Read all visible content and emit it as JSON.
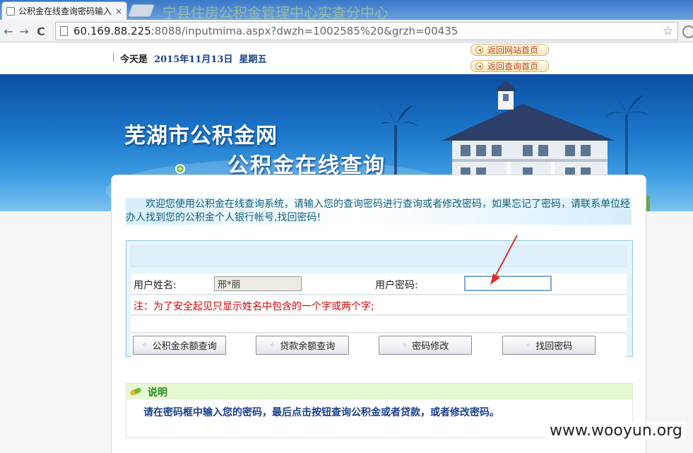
{
  "browser": {
    "tab_title": "公积金在线查询密码输入",
    "tab_close": "×",
    "background_text": "宁县住房公积金管理中心实查分中心",
    "url_host": "60.169.88.225",
    "url_rest": ":8088/inputmima.aspx?dwzh=1002585%20&grzh=00435",
    "back_glyph": "←",
    "forward_glyph": "→",
    "reload_glyph": "C",
    "star_glyph": "☆"
  },
  "topbar": {
    "today_label": "今天是",
    "date": "2015年11月13日",
    "weekday": "星期五",
    "link_home": "返回网站首页",
    "link_query_home": "返回查询首页"
  },
  "banner": {
    "title": "芜湖市公积金网",
    "subtitle": "公积金在线查询",
    "plus_glyph": "+"
  },
  "welcome": {
    "text": "欢迎您使用公积金在线查询系统，请输入您的查询密码进行查询或者修改密码，如果忘记了密码，请联系单位经办人找到您的公积金个人银行帐号,找回密码!"
  },
  "form": {
    "name_label": "用户姓名:",
    "name_value": "邢*丽",
    "password_label": "用户密码:",
    "password_value": "",
    "note": "注：为了安全起见只显示姓名中包含的一个字或两个字;",
    "buttons": {
      "fund_balance": "公积金余额查询",
      "loan_balance": "贷款余额查询",
      "change_password": "密码修改",
      "recover_password": "找回密码"
    },
    "btn_dots": "⁘"
  },
  "instructions": {
    "title": "说明",
    "text": "请在密码框中输入您的密码，最后点击按钮查询公积金或者贷款，或者修改密码。"
  },
  "watermark": "www.wooyun.org",
  "colors": {
    "banner_dark": "#0b4fa3",
    "banner_light": "#7cc3ef",
    "note_red": "#d40000",
    "link_orange": "#c7481e",
    "text_blue": "#1a3f8e"
  }
}
